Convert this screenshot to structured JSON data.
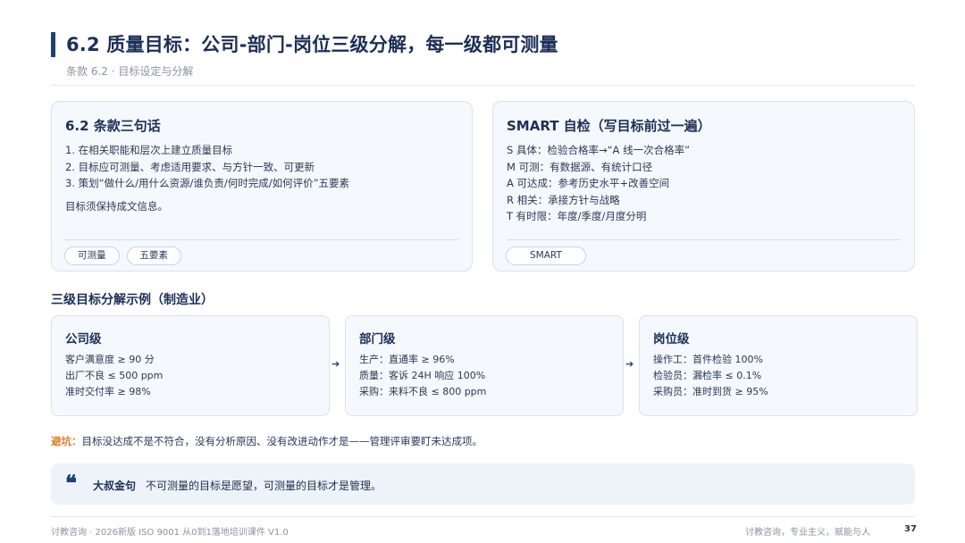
{
  "header": {
    "title": "6.2 质量目标：公司-部门-岗位三级分解，每一级都可测量",
    "subtitle": "条款 6.2 · 目标设定与分解"
  },
  "clause_card": {
    "title": "6.2 条款三句话",
    "lines": [
      "1. 在相关职能和层次上建立质量目标",
      "2. 目标应可测量、考虑适用要求、与方针一致、可更新",
      "3. 策划“做什么/用什么资源/谁负责/何时完成/如何评价”五要素"
    ],
    "note": "目标须保持成文信息。",
    "tags": [
      "可测量",
      "五要素"
    ]
  },
  "smart_card": {
    "title": "SMART 自检（写目标前过一遍）",
    "lines": [
      "S 具体：检验合格率→“A 线一次合格率”",
      "M 可测：有数据源、有统计口径",
      "A 可达成：参考历史水平+改善空间",
      "R 相关：承接方针与战略",
      "T 有时限：年度/季度/月度分明"
    ],
    "tags": [
      "SMART"
    ]
  },
  "breakdown": {
    "title": "三级目标分解示例（制造业）",
    "levels": [
      {
        "title": "公司级",
        "lines": [
          "客户满意度 ≥ 90 分",
          "出厂不良 ≤ 500 ppm",
          "准时交付率 ≥ 98%"
        ]
      },
      {
        "title": "部门级",
        "lines": [
          "生产：直通率 ≥ 96%",
          "质量：客诉 24H 响应 100%",
          "采购：来料不良 ≤ 800 ppm"
        ]
      },
      {
        "title": "岗位级",
        "lines": [
          "操作工：首件检验 100%",
          "检验员：漏检率 ≤ 0.1%",
          "采购员：准时到货 ≥ 95%"
        ]
      }
    ],
    "arrow": "➔"
  },
  "pitfall": {
    "label": "避坑：",
    "text": "目标没达成不是不符合，没有分析原因、没有改进动作才是——管理评审要盯未达成项。"
  },
  "quote": {
    "icon": "quote-icon",
    "mark": "❝",
    "label": "大叔金句",
    "text": "不可测量的目标是愿望，可测量的目标才是管理。"
  },
  "footer": {
    "left": "讨教咨询 · 2026新版 ISO 9001 从0到1落地培训课件 V1.0",
    "right": "讨教咨询，专业主义，赋能与人",
    "page": "37"
  },
  "colors": {
    "accent": "#1f3f7a",
    "title": "#1c2f57",
    "warning": "#d9822b",
    "card_bg": "#f5f8fc",
    "quote_bg": "#eef3fa"
  }
}
